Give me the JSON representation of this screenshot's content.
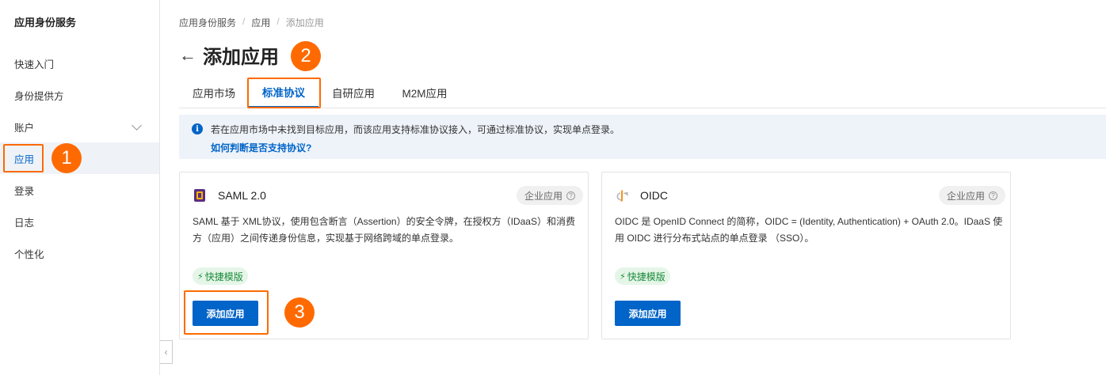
{
  "sidebar": {
    "title": "应用身份服务",
    "items": [
      {
        "label": "快速入门"
      },
      {
        "label": "身份提供方"
      },
      {
        "label": "账户"
      },
      {
        "label": "应用"
      },
      {
        "label": "登录"
      },
      {
        "label": "日志"
      },
      {
        "label": "个性化"
      }
    ]
  },
  "annotations": {
    "step1": "1",
    "step2": "2",
    "step3": "3",
    "accent": "#ff6a00"
  },
  "breadcrumb": {
    "items": [
      "应用身份服务",
      "应用",
      "添加应用"
    ],
    "separator": "/"
  },
  "page": {
    "back": "←",
    "title": "添加应用"
  },
  "tabs": [
    {
      "label": "应用市场"
    },
    {
      "label": "标准协议",
      "active": true
    },
    {
      "label": "自研应用"
    },
    {
      "label": "M2M应用"
    }
  ],
  "notice": {
    "icon": "info-icon",
    "text": "若在应用市场中未找到目标应用，而该应用支持标准协议接入，可通过标准协议，实现单点登录。",
    "link": "如何判断是否支持协议?"
  },
  "cards": [
    {
      "title": "SAML 2.0",
      "tag": "企业应用",
      "description": "SAML 基于 XML协议，使用包含断言（Assertion）的安全令牌，在授权方（IDaaS）和消费方（应用）之间传递身份信息，实现基于网络跨域的单点登录。",
      "quick_label": "快捷模版",
      "button": "添加应用"
    },
    {
      "title": "OIDC",
      "tag": "企业应用",
      "description": "OIDC 是 OpenID Connect 的简称，OIDC = (Identity, Authentication) + OAuth 2.0。IDaaS 使用 OIDC 进行分布式站点的单点登录 （SSO）。",
      "quick_label": "快捷模版",
      "button": "添加应用"
    }
  ],
  "colors": {
    "primary": "#0064c8",
    "highlight": "#ff6a00",
    "success": "#1a8a3a"
  }
}
